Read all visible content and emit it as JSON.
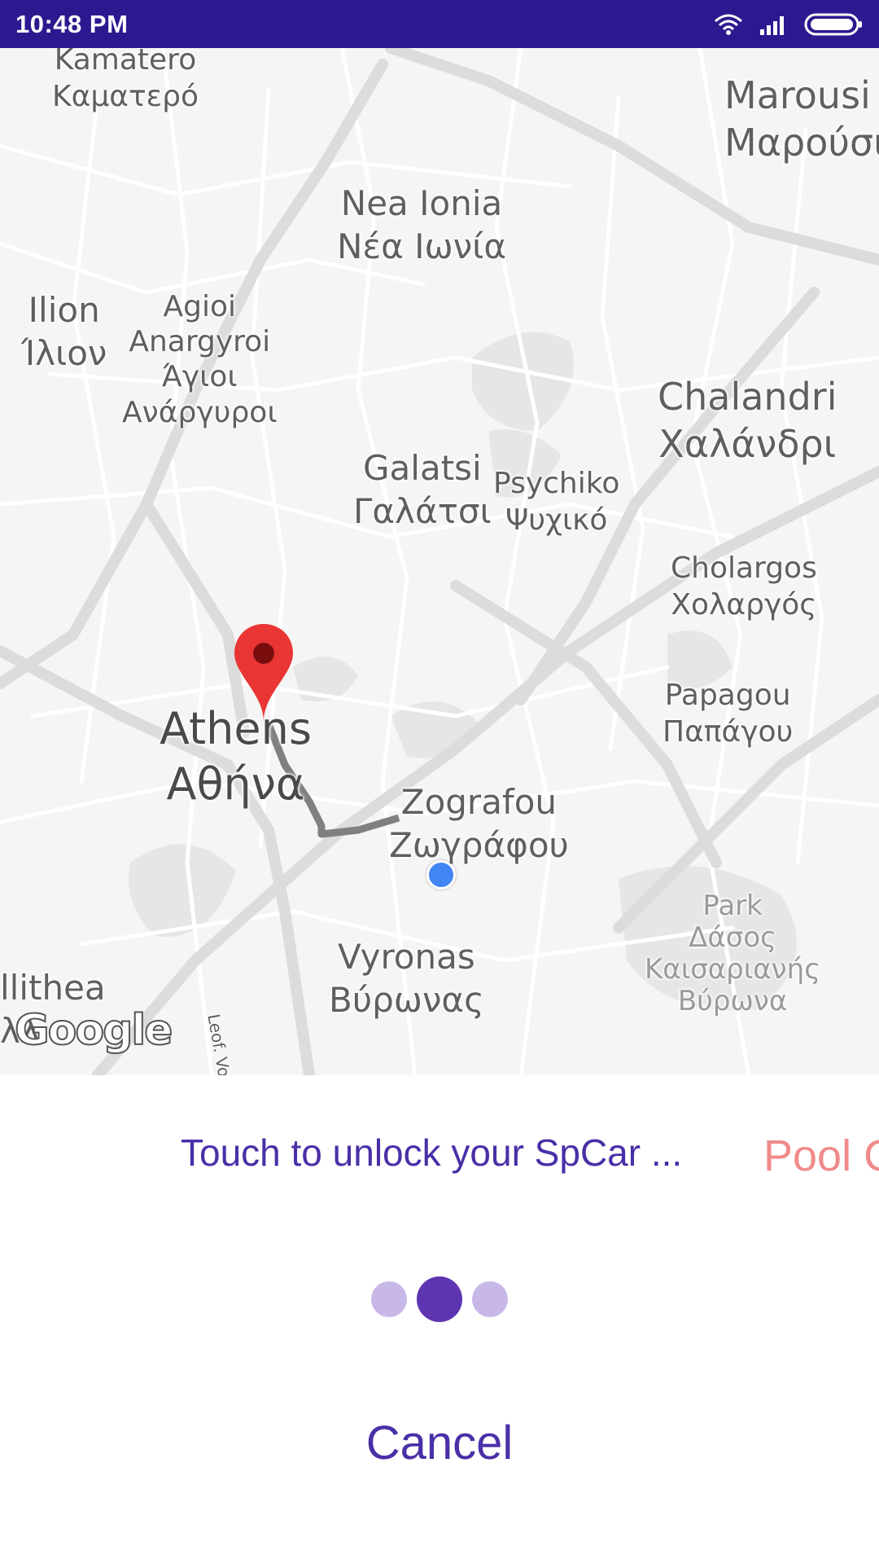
{
  "status_bar": {
    "time": "10:48 PM",
    "icons": [
      "wifi-icon",
      "signal-icon",
      "battery-icon"
    ],
    "background": "#2b1a8f"
  },
  "map": {
    "labels": {
      "kamatero": {
        "en": "Kamatero",
        "gr": "Καματερό"
      },
      "marousi": {
        "en": "Marousi",
        "gr": "Μαρούσι"
      },
      "nea_ionia": {
        "en": "Nea Ionia",
        "gr": "Νέα Ιωνία"
      },
      "ilion": {
        "en": "Ilion",
        "gr": "Ίλιον"
      },
      "agioi_anargyroi": {
        "en1": "Agioi",
        "en2": "Anargyroi",
        "gr1": "Άγιοι",
        "gr2": "Ανάργυροι"
      },
      "chalandri": {
        "en": "Chalandri",
        "gr": "Χαλάνδρι"
      },
      "galatsi": {
        "en": "Galatsi",
        "gr": "Γαλάτσι"
      },
      "psychiko": {
        "en": "Psychiko",
        "gr": "Ψυχικό"
      },
      "cholargos": {
        "en": "Cholargos",
        "gr": "Χολαργός"
      },
      "papagou": {
        "en": "Papagou",
        "gr": "Παπάγου"
      },
      "athens": {
        "en": "Athens",
        "gr": "Αθήνα"
      },
      "zografou": {
        "en": "Zografou",
        "gr": "Ζωγράφου"
      },
      "park": {
        "l1": "Park",
        "l2": "Δάσος",
        "l3": "Καισαριανής",
        "l4": "Βύρωνα"
      },
      "kallithea": {
        "en": "llithea",
        "gr": "λλ"
      },
      "vyronas": {
        "en": "Vyronas",
        "gr": "Βύρωνας"
      },
      "road": "Leof. Vouliagmeni"
    },
    "attribution": "Google",
    "destination_icon": "map-pin-icon",
    "current_location_icon": "location-dot-icon"
  },
  "bottom_panel": {
    "unlock_text": "Touch to unlock your SpCar ...",
    "pool_text": "Pool C",
    "pager_dots": [
      {
        "state": "inactive",
        "color": "#c8b8e8"
      },
      {
        "state": "active",
        "color": "#5e35b1"
      },
      {
        "state": "inactive",
        "color": "#c8b8e8"
      }
    ],
    "cancel_label": "Cancel"
  }
}
